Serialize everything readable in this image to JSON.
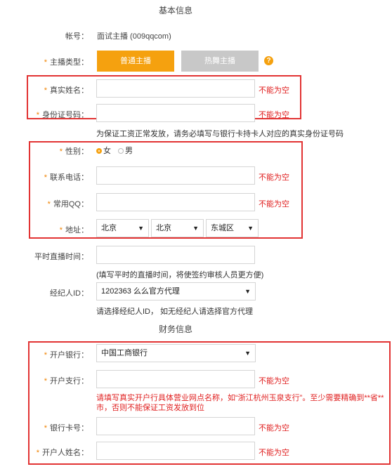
{
  "basic_title": "基本信息",
  "finance_title": "财务信息",
  "account": {
    "label": "帐号：",
    "value": "面试主播 (009qqcom)"
  },
  "anchor_type": {
    "label": "主播类型：",
    "primary": "普通主播",
    "secondary": "热舞主播",
    "help": "?"
  },
  "real_name": {
    "label": "真实姓名：",
    "error": "不能为空"
  },
  "id_number": {
    "label": "身份证号码：",
    "error": "不能为空",
    "hint": "为保证工资正常发放，请务必填写与银行卡持卡人对应的真实身份证号码"
  },
  "gender": {
    "label": "性别：",
    "female": "女",
    "male": "男"
  },
  "phone": {
    "label": "联系电话：",
    "error": "不能为空"
  },
  "qq": {
    "label": "常用QQ：",
    "error": "不能为空"
  },
  "address": {
    "label": "地址：",
    "province": "北京",
    "city": "北京",
    "district": "东城区"
  },
  "live_time": {
    "label": "平时直播时间：",
    "hint": "(填写平时的直播时间，将使签约审核人员更方便)"
  },
  "agent": {
    "label": "经纪人ID：",
    "value": "1202363 么么官方代理",
    "hint": "请选择经纪人ID， 如无经纪人请选择官方代理"
  },
  "bank": {
    "label": "开户银行：",
    "value": "中国工商银行"
  },
  "branch": {
    "label": "开户支行：",
    "error": "不能为空",
    "hint": "请填写真实开户行具体营业网点名称，如“浙江杭州玉泉支行”。至少需要精确到**省**市，否则不能保证工资发放到位"
  },
  "card": {
    "label": "银行卡号：",
    "error": "不能为空"
  },
  "holder": {
    "label": "开户人姓名：",
    "error": "不能为空"
  },
  "colors": {
    "accent": "#f5a10f",
    "error": "#e02020",
    "box": "#e23333"
  }
}
